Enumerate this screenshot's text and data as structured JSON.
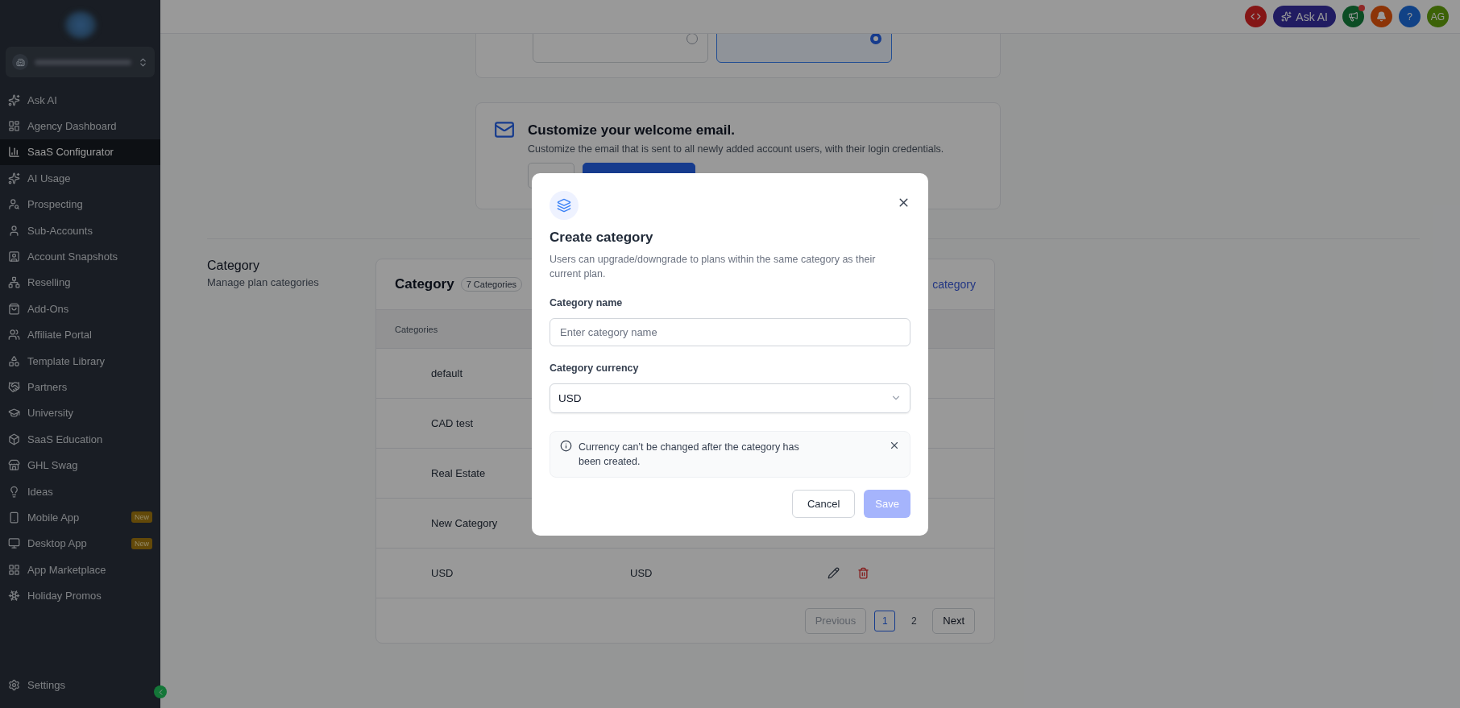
{
  "sidebar": {
    "items": [
      {
        "label": "Ask AI",
        "selected": false
      },
      {
        "label": "Agency Dashboard",
        "selected": false
      },
      {
        "label": "SaaS Configurator",
        "selected": true
      },
      {
        "label": "AI Usage",
        "selected": false
      },
      {
        "label": "Prospecting",
        "selected": false
      },
      {
        "label": "Sub-Accounts",
        "selected": false
      },
      {
        "label": "Account Snapshots",
        "selected": false
      },
      {
        "label": "Reselling",
        "selected": false
      },
      {
        "label": "Add-Ons",
        "selected": false
      },
      {
        "label": "Affiliate Portal",
        "selected": false
      },
      {
        "label": "Template Library",
        "selected": false
      },
      {
        "label": "Partners",
        "selected": false
      },
      {
        "label": "University",
        "selected": false
      },
      {
        "label": "SaaS Education",
        "selected": false
      },
      {
        "label": "GHL Swag",
        "selected": false
      },
      {
        "label": "Ideas",
        "selected": false
      },
      {
        "label": "Mobile App",
        "selected": false,
        "badge": "New"
      },
      {
        "label": "Desktop App",
        "selected": false,
        "badge": "New"
      },
      {
        "label": "App Marketplace",
        "selected": false
      },
      {
        "label": "Holiday Promos",
        "selected": false
      }
    ],
    "footer": {
      "label": "Settings"
    }
  },
  "topbar": {
    "ask_ai": "Ask AI",
    "avatar": "AG",
    "help": "?"
  },
  "name_options": [
    {
      "selected": false
    },
    {
      "selected": true
    }
  ],
  "email_card": {
    "title": "Customize your welcome email.",
    "description": "Customize the email that is sent to all newly added account users, with their login credentials."
  },
  "category_section": {
    "title": "Category",
    "subtitle": "Manage plan categories",
    "card": {
      "title": "Category",
      "count": "7 Categories",
      "link": "category",
      "table": {
        "columns": [
          "Categories"
        ],
        "rows": [
          {
            "name": "default"
          },
          {
            "name": "CAD test"
          },
          {
            "name": "Real Estate"
          },
          {
            "name": "New Category"
          },
          {
            "name": "USD",
            "currency": "USD",
            "actions": true
          }
        ]
      },
      "pagination": {
        "previous": "Previous",
        "next": "Next",
        "pages": [
          {
            "label": "1",
            "selected": true
          },
          {
            "label": "2",
            "selected": false
          }
        ]
      }
    }
  },
  "modal": {
    "title": "Create category",
    "description": "Users can upgrade/downgrade to plans within the same category as their current plan.",
    "fields": [
      {
        "kind": "input",
        "label": "Category name",
        "placeholder": "Enter category name"
      },
      {
        "kind": "select",
        "label": "Category currency",
        "value": "USD"
      }
    ],
    "alert": "Currency can’t be changed after the category has been created.",
    "cancel": "Cancel",
    "save": {
      "label": "Save",
      "disabled": true
    }
  }
}
